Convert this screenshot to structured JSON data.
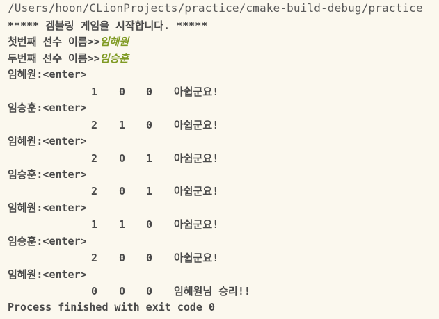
{
  "console": {
    "run_path": "/Users/hoon/CLionProjects/practice/cmake-build-debug/practice",
    "banner": "***** 겜블링 게임을 시작합니다. *****",
    "prompt_player1": "첫번째 선수 이름>>",
    "input_player1": "임혜원",
    "prompt_player2": "두번째 선수 이름>>",
    "input_player2": "임승훈",
    "turns": [
      {
        "prompt": "임혜원:<enter>",
        "d1": "1",
        "d2": "0",
        "d3": "0",
        "msg": "아쉽군요!"
      },
      {
        "prompt": "임승훈:<enter>",
        "d1": "2",
        "d2": "1",
        "d3": "0",
        "msg": "아쉽군요!"
      },
      {
        "prompt": "임혜원:<enter>",
        "d1": "2",
        "d2": "0",
        "d3": "1",
        "msg": "아쉽군요!"
      },
      {
        "prompt": "임승훈:<enter>",
        "d1": "2",
        "d2": "0",
        "d3": "1",
        "msg": "아쉽군요!"
      },
      {
        "prompt": "임혜원:<enter>",
        "d1": "1",
        "d2": "1",
        "d3": "0",
        "msg": "아쉽군요!"
      },
      {
        "prompt": "임승훈:<enter>",
        "d1": "2",
        "d2": "0",
        "d3": "0",
        "msg": "아쉽군요!"
      },
      {
        "prompt": "임혜원:<enter>",
        "d1": "0",
        "d2": "0",
        "d3": "0",
        "msg": "임혜원님 승리!!"
      }
    ],
    "exit_message": "Process finished with exit code 0",
    "colors": {
      "background": "#fbf8ee",
      "text": "#4a4a4a",
      "user_input": "#7f9a23"
    }
  }
}
